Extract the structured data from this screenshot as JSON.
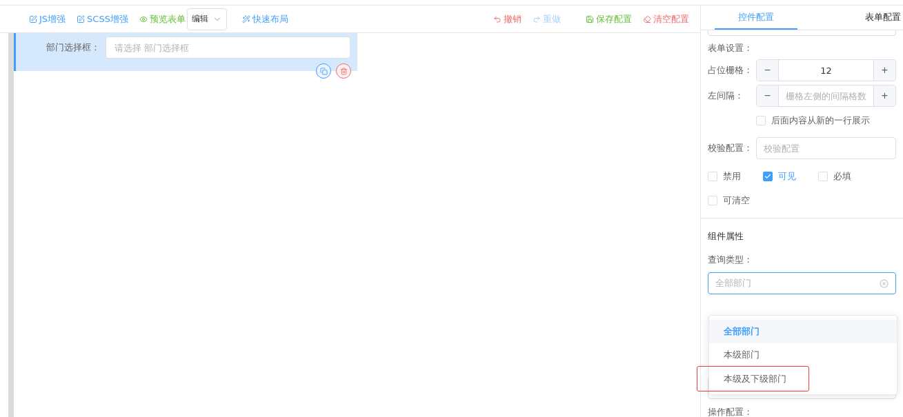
{
  "toolbar": {
    "left": [
      {
        "kind": "edit",
        "label": "JS增强"
      },
      {
        "kind": "edit",
        "label": "SCSS增强"
      },
      {
        "kind": "preview",
        "label": "预览表单"
      }
    ],
    "mode_select": {
      "value": "编辑"
    },
    "layout_button": {
      "label": "快速布局"
    },
    "right": [
      {
        "kind": "undo",
        "label": "撤销",
        "disabled": false
      },
      {
        "kind": "redo",
        "label": "重做",
        "disabled": true
      },
      {
        "kind": "save",
        "label": "保存配置",
        "disabled": false
      },
      {
        "kind": "clear",
        "label": "清空配置",
        "disabled": false
      }
    ]
  },
  "canvas": {
    "widget": {
      "label": "部门选择框：",
      "placeholder": "请选择 部门选择框",
      "selected": true
    }
  },
  "panel": {
    "tabs": [
      {
        "label": "控件配置",
        "selected": true
      },
      {
        "label": "表单配置",
        "selected": false
      }
    ],
    "form_settings_title": "表单设置：",
    "span": {
      "label": "占位栅格：",
      "value": "12",
      "minus": "−",
      "plus": "+"
    },
    "offset": {
      "label": "左间隔：",
      "placeholder": "栅格左侧的间隔格数",
      "minus": "−",
      "plus": "+"
    },
    "new_line": {
      "label": "后面内容从新的一行展示",
      "checked": false
    },
    "validation": {
      "label": "校验配置：",
      "placeholder": "校验配置"
    },
    "flags": [
      {
        "label": "禁用",
        "checked": false
      },
      {
        "label": "可见",
        "checked": true
      },
      {
        "label": "必填",
        "checked": false
      },
      {
        "label": "可清空",
        "checked": false
      }
    ],
    "component_title": "组件属性",
    "query_type": {
      "label": "查询类型：",
      "placeholder": "全部部门",
      "expanded": true,
      "options": [
        {
          "label": "全部部门",
          "selected": true,
          "highlighted": false
        },
        {
          "label": "本级部门",
          "selected": false,
          "highlighted": false
        },
        {
          "label": "本级及下级部门",
          "selected": false,
          "highlighted": true
        }
      ]
    },
    "action_title": "操作配置："
  }
}
